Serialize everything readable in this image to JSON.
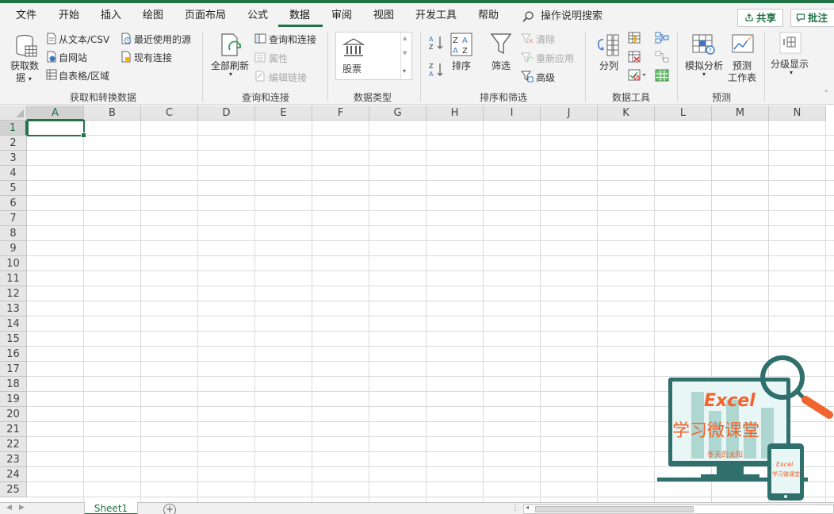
{
  "tabs": [
    "文件",
    "开始",
    "插入",
    "绘图",
    "页面布局",
    "公式",
    "数据",
    "审阅",
    "视图",
    "开发工具",
    "帮助"
  ],
  "active_tab": "数据",
  "search": {
    "label": "操作说明搜索"
  },
  "share_label": "共享",
  "comment_label": "批注",
  "ribbon": {
    "group1": {
      "label": "获取和转换数据",
      "get_data_1": "获取数",
      "get_data_2": "据",
      "from_text": "从文本/CSV",
      "from_web": "自网站",
      "from_table": "自表格/区域",
      "recent_sources": "最近使用的源",
      "existing_conn": "现有连接"
    },
    "group2": {
      "label": "查询和连接",
      "refresh_all": "全部刷新",
      "queries_conn": "查询和连接",
      "properties": "属性",
      "edit_links": "编辑链接"
    },
    "group3": {
      "label": "数据类型",
      "stock": "股票"
    },
    "group4": {
      "label": "排序和筛选",
      "sort": "排序",
      "filter": "筛选",
      "clear": "清除",
      "reapply": "重新应用",
      "advanced": "高级"
    },
    "group5": {
      "label": "数据工具",
      "text_to_columns": "分列"
    },
    "group6": {
      "label": "预测",
      "what_if": "模拟分析",
      "forecast_1": "预测",
      "forecast_2": "工作表"
    },
    "group7": {
      "outline": "分级显示"
    }
  },
  "columns": [
    "A",
    "B",
    "C",
    "D",
    "E",
    "F",
    "G",
    "H",
    "I",
    "J",
    "K",
    "L",
    "M",
    "N"
  ],
  "rows": [
    "1",
    "2",
    "3",
    "4",
    "5",
    "6",
    "7",
    "8",
    "9",
    "10",
    "11",
    "12",
    "13",
    "14",
    "15",
    "16",
    "17",
    "18",
    "19",
    "20",
    "21",
    "22",
    "23",
    "24",
    "25"
  ],
  "selected_cell": {
    "col": "A",
    "row": "1"
  },
  "sheet_tab": "Sheet1",
  "add_sheet": "+",
  "logo": {
    "title": "Excel",
    "subtitle": "学习微课堂",
    "author": "冬天的太阳",
    "phone_title": "Excel",
    "phone_subtitle": "学习微课堂"
  },
  "colors": {
    "accent": "#217346",
    "logo_teal": "#2f6f6c",
    "logo_orange": "#f0642e"
  }
}
